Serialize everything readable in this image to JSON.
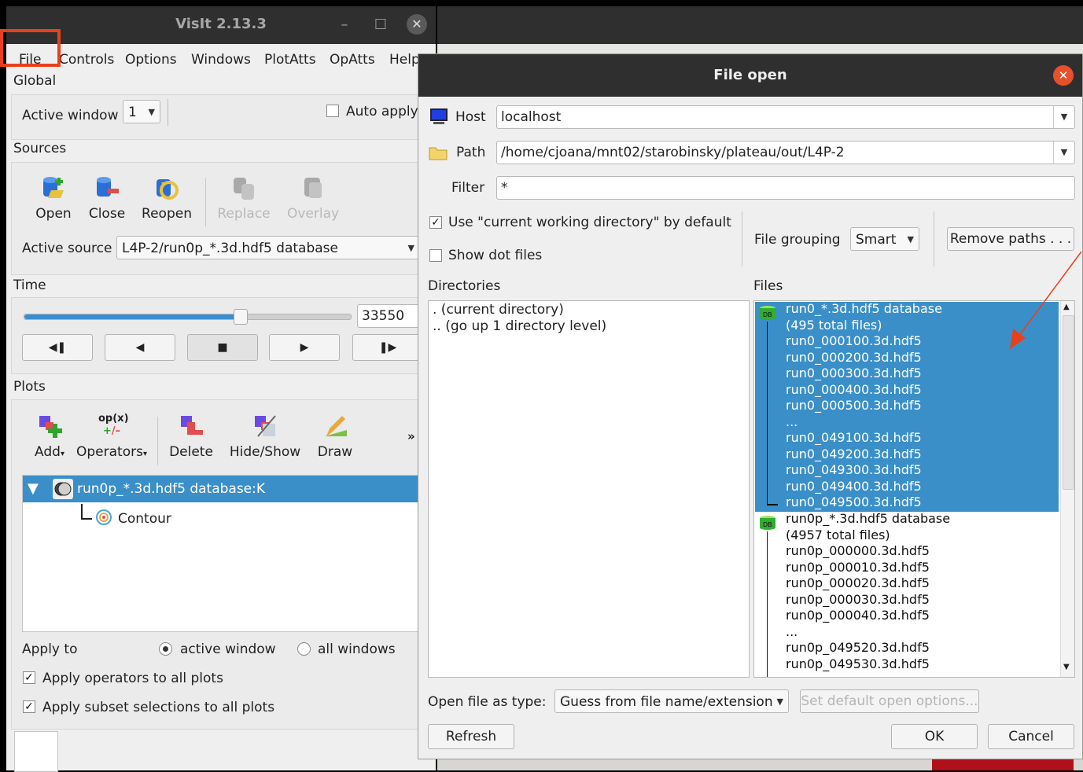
{
  "main_window": {
    "title": "VisIt 2.13.3",
    "menu": [
      "File",
      "Controls",
      "Options",
      "Windows",
      "PlotAtts",
      "OpAtts",
      "Help"
    ],
    "global": {
      "label": "Global",
      "active_window_label": "Active window",
      "active_window_value": "1",
      "auto_apply_label": "Auto apply"
    },
    "sources": {
      "label": "Sources",
      "buttons": [
        "Open",
        "Close",
        "Reopen",
        "Replace",
        "Overlay"
      ],
      "active_source_label": "Active source",
      "active_source_value": "L4P-2/run0p_*.3d.hdf5 database"
    },
    "time": {
      "label": "Time",
      "slider_fraction": 0.66,
      "value": "33550"
    },
    "plots": {
      "label": "Plots",
      "buttons": [
        "Add",
        "Operators",
        "Delete",
        "Hide/Show",
        "Draw"
      ],
      "operators_icon_text": "op(x)",
      "overflow": "»",
      "plot_item": "run0p_*.3d.hdf5 database:K",
      "sub_item": "Contour",
      "apply_to_label": "Apply to",
      "radio_active": "active window",
      "radio_all": "all windows",
      "apply_ops": "Apply operators to all plots",
      "apply_subset": "Apply subset selections to all plots"
    }
  },
  "file_open": {
    "title": "File open",
    "host_label": "Host",
    "host_value": "localhost",
    "path_label": "Path",
    "path_value": "/home/cjoana/mnt02/starobinsky/plateau/out/L4P-2",
    "filter_label": "Filter",
    "filter_value": "*",
    "use_cwd_label": "Use \"current working directory\" by default",
    "show_dot_label": "Show dot files",
    "grouping_label": "File grouping",
    "grouping_value": "Smart",
    "remove_paths": "Remove paths . . .",
    "directories_label": "Directories",
    "files_label": "Files",
    "directories": [
      ". (current directory)",
      ".. (go up 1 directory level)"
    ],
    "db_badge": "DB",
    "group1": {
      "name": "run0_*.3d.hdf5 database",
      "count": "(495 total files)",
      "files": [
        "run0_000100.3d.hdf5",
        "run0_000200.3d.hdf5",
        "run0_000300.3d.hdf5",
        "run0_000400.3d.hdf5",
        "run0_000500.3d.hdf5",
        "...",
        "run0_049100.3d.hdf5",
        "run0_049200.3d.hdf5",
        "run0_049300.3d.hdf5",
        "run0_049400.3d.hdf5",
        "run0_049500.3d.hdf5"
      ]
    },
    "group2": {
      "name": "run0p_*.3d.hdf5 database",
      "count": "(4957 total files)",
      "files": [
        "run0p_000000.3d.hdf5",
        "run0p_000010.3d.hdf5",
        "run0p_000020.3d.hdf5",
        "run0p_000030.3d.hdf5",
        "run0p_000040.3d.hdf5",
        "...",
        "run0p_049520.3d.hdf5",
        "run0p_049530.3d.hdf5"
      ]
    },
    "open_as_label": "Open file as type:",
    "open_as_value": "Guess from file name/extension",
    "set_default": "Set default open options...",
    "refresh": "Refresh",
    "ok": "OK",
    "cancel": "Cancel"
  },
  "colors": {
    "selection": "#3a8fc8",
    "annotation": "#e8401c",
    "titlebar": "#2f2f2f",
    "close_button": "#e8502a"
  }
}
